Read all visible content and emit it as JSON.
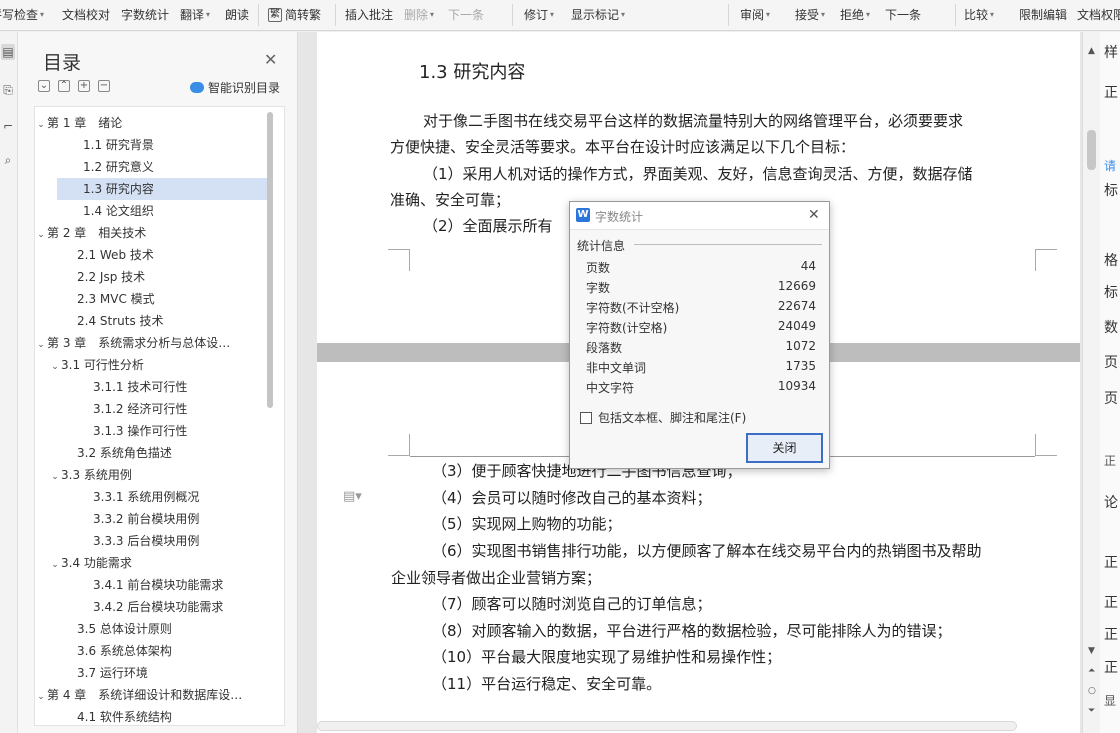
{
  "ribbon": {
    "items": [
      {
        "label": "拼写检查",
        "dd": true
      },
      {
        "label": "文档校对"
      },
      {
        "label": "字数统计"
      },
      {
        "label": "翻译",
        "dd": true
      },
      {
        "label": "朗读"
      },
      {
        "label": "简转繁",
        "icon": "繁"
      },
      {
        "label": "插入批注"
      },
      {
        "label": "删除",
        "dd": true,
        "disabled": true
      },
      {
        "label": "下一条",
        "disabled": true
      },
      {
        "label": "修订",
        "dd": true
      },
      {
        "label": "显示标记",
        "dd": true
      },
      {
        "label": "审阅",
        "dd": true
      },
      {
        "label": "接受",
        "dd": true
      },
      {
        "label": "拒绝",
        "dd": true
      },
      {
        "label": "下一条"
      },
      {
        "label": "比较",
        "dd": true
      },
      {
        "label": "限制编辑"
      },
      {
        "label": "文档权限"
      }
    ]
  },
  "toc": {
    "title": "目录",
    "smart_label": "智能识别目录",
    "items": [
      {
        "text": "第 1 章　绪论",
        "arrow": "⌄"
      },
      {
        "text": "1.1  研究背景"
      },
      {
        "text": "1.2  研究意义"
      },
      {
        "text": "1.3  研究内容",
        "selected": true
      },
      {
        "text": "1.4  论文组织"
      },
      {
        "text": "第 2 章　相关技术",
        "arrow": "⌄"
      },
      {
        "text": "2.1 Web 技术"
      },
      {
        "text": "2.2 Jsp 技术"
      },
      {
        "text": "2.3 MVC 模式"
      },
      {
        "text": "2.4 Struts 技术"
      },
      {
        "text": "第 3 章　系统需求分析与总体设…",
        "arrow": "⌄"
      },
      {
        "text": "3.1 可行性分析",
        "arrow": "⌄"
      },
      {
        "text": "3.1.1  技术可行性"
      },
      {
        "text": "3.1.2  经济可行性"
      },
      {
        "text": "3.1.3  操作可行性"
      },
      {
        "text": "3.2  系统角色描述"
      },
      {
        "text": "3.3  系统用例",
        "arrow": "⌄"
      },
      {
        "text": "3.3.1  系统用例概况"
      },
      {
        "text": "3.3.2  前台模块用例"
      },
      {
        "text": "3.3.3  后台模块用例"
      },
      {
        "text": "3.4  功能需求",
        "arrow": "⌄"
      },
      {
        "text": "3.4.1  前台模块功能需求"
      },
      {
        "text": "3.4.2  后台模块功能需求"
      },
      {
        "text": "3.5  总体设计原则"
      },
      {
        "text": "3.6  系统总体架构"
      },
      {
        "text": "3.7  运行环境"
      },
      {
        "text": "第 4 章　系统详细设计和数据库设…",
        "arrow": "⌄"
      },
      {
        "text": "4.1  软件系统结构"
      }
    ]
  },
  "document": {
    "heading": "1.3  研究内容",
    "page1_lines": [
      "对于像二手图书在线交易平台这样的数据流量特别大的网络管理平台，必须要要求",
      "方便快捷、安全灵活等要求。本平台在设计时应该满足以下几个目标：",
      "（1）采用人机对话的操作方式，界面美观、友好，信息查询灵活、方便，数据存储",
      "准确、安全可靠；",
      "（2）全面展示所有"
    ],
    "page2_lines": [
      "（3）便于顾客快捷地进行二手图书信息查询；",
      "（4）会员可以随时修改自己的基本资料；",
      "（5）实现网上购物的功能；",
      "（6）实现图书销售排行功能，以方便顾客了解本在线交易平台内的热销图书及帮助",
      "企业领导者做出企业营销方案；",
      "（7）顾客可以随时浏览自己的订单信息；",
      "（8）对顾客输入的数据，平台进行严格的数据检验，尽可能排除人为的错误；",
      "（10）平台最大限度地实现了易维护性和易操作性；",
      "（11）平台运行稳定、安全可靠。"
    ]
  },
  "right_panel": {
    "chars": [
      "样",
      "正",
      "请",
      "标",
      "格",
      "标",
      "数",
      "页",
      "页",
      "正",
      "论",
      "正",
      "正",
      "正",
      "正",
      "显"
    ]
  },
  "dialog": {
    "title": "字数统计",
    "section": "统计信息",
    "stats": [
      {
        "label": "页数",
        "value": "44"
      },
      {
        "label": "字数",
        "value": "12669"
      },
      {
        "label": "字符数(不计空格)",
        "value": "22674"
      },
      {
        "label": "字符数(计空格)",
        "value": "24049"
      },
      {
        "label": "段落数",
        "value": "1072"
      },
      {
        "label": "非中文单词",
        "value": "1735"
      },
      {
        "label": "中文字符",
        "value": "10934"
      }
    ],
    "checkbox_label": "包括文本框、脚注和尾注(F)",
    "close_label": "关闭"
  },
  "colors": {
    "selection": "#d4e0f3",
    "accent": "#3a6fc4",
    "logo": "#2b77d9"
  }
}
